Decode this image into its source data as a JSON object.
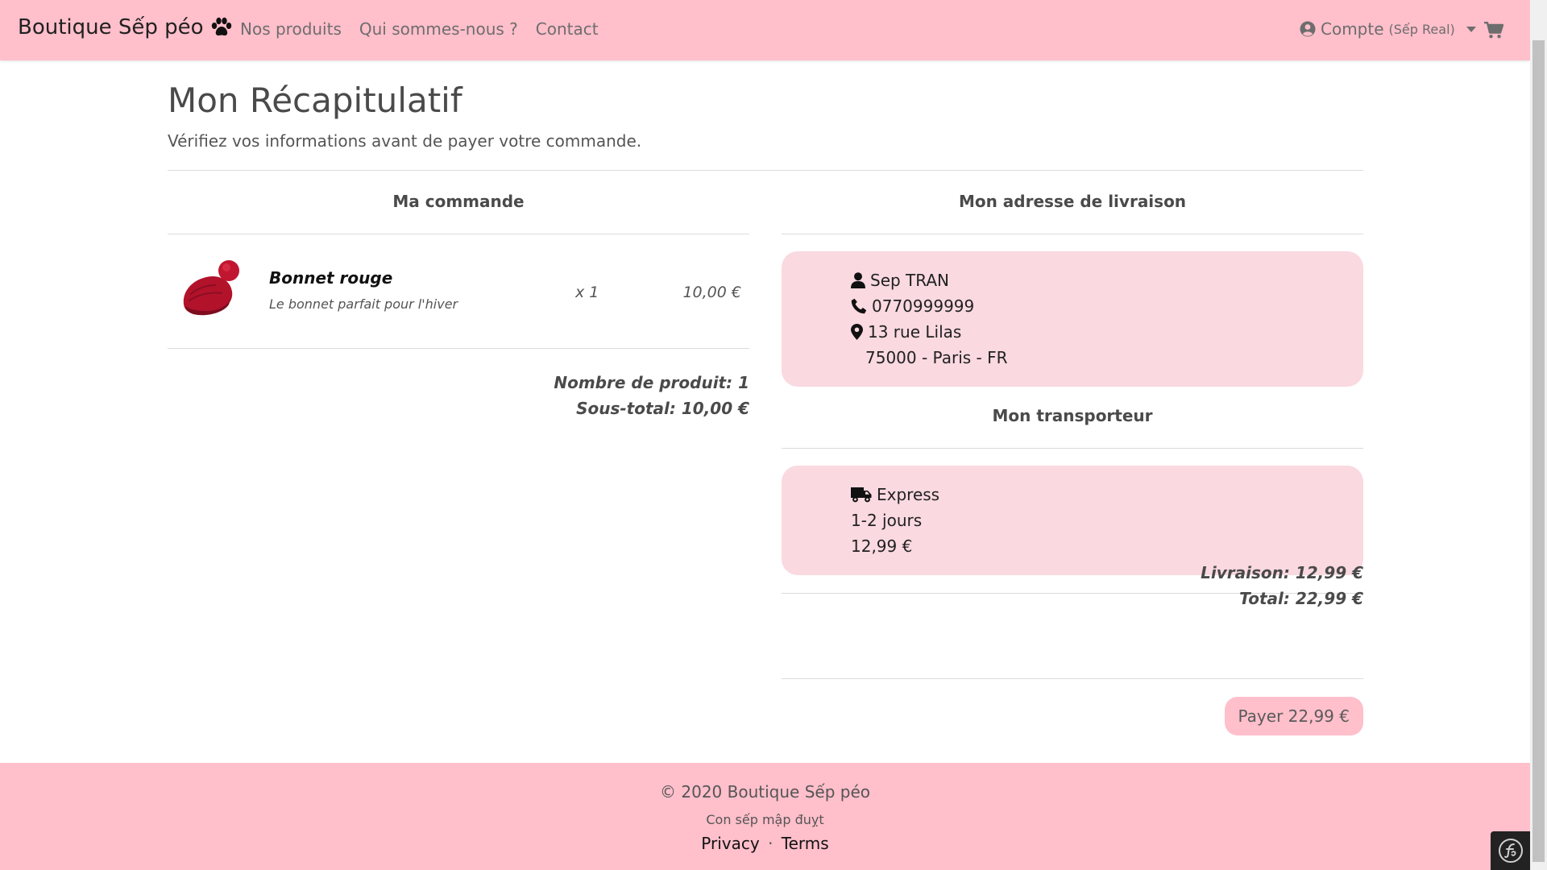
{
  "navbar": {
    "brand": "Boutique Sếp péo",
    "brand_icon": "paw-icon",
    "links": [
      "Nos produits",
      "Qui sommes-nous ?",
      "Contact"
    ],
    "account_label": "Compte",
    "account_user": "(Sếp Real)",
    "cart_icon": "cart-icon"
  },
  "page": {
    "title": "Mon Récapitulatif",
    "subtitle": "Vérifiez vos informations avant de payer votre commande."
  },
  "order": {
    "heading": "Ma commande",
    "items": [
      {
        "name": "Bonnet rouge",
        "description": "Le bonnet parfait pour l'hiver",
        "quantity": "x 1",
        "price": "10,00 €"
      }
    ],
    "product_count": "Nombre de produit: 1",
    "subtotal": "Sous-total: 10,00 €"
  },
  "delivery": {
    "heading": "Mon adresse de livraison",
    "name": "Sep TRAN",
    "phone": "0770999999",
    "street": "13 rue Lilas",
    "city_line": "75000 - Paris - FR"
  },
  "carrier": {
    "heading": "Mon transporteur",
    "name": "Express",
    "delay": "1-2 jours",
    "price": "12,99 €"
  },
  "summary": {
    "shipping": "Livraison: 12,99 €",
    "total": "Total: 22,99 €",
    "pay_button": "Payer 22,99 €"
  },
  "footer": {
    "copyright": "© 2020 Boutique Sếp péo",
    "tagline": "Con sếp mập đuỵt",
    "privacy": "Privacy",
    "separator": "·",
    "terms": "Terms"
  },
  "colors": {
    "brand_pink": "#ffbfcb",
    "card_pink": "#fad9e1"
  }
}
